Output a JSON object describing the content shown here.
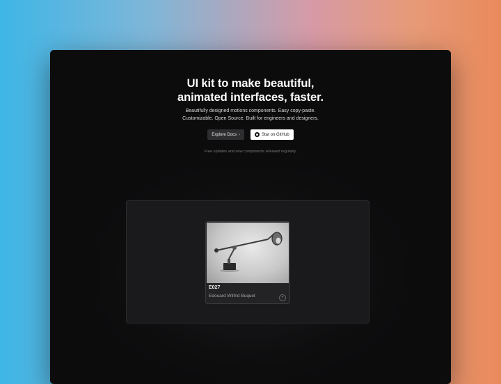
{
  "hero": {
    "headline_line1": "UI kit to make beautiful,",
    "headline_line2": "animated interfaces, faster.",
    "subtitle_line1": "Beautifully designed motions components. Easy copy-paste.",
    "subtitle_line2": "Customizable. Open Source. Built for engineers and designers.",
    "primary_button_label": "Explore Docs",
    "primary_button_icon": "arrow-right-icon",
    "secondary_button_label": "Star on GitHub",
    "secondary_button_icon": "github-icon",
    "note": "Free updates and new components released regularly."
  },
  "showcase": {
    "card": {
      "image_icon": "desk-lamp-image",
      "code": "E027",
      "name": "Edouard Wilfrid Buquet",
      "action_icon": "plus-icon"
    }
  },
  "colors": {
    "background_left": "#3eb6e6",
    "background_right": "#e98a5b",
    "window": "#0c0c0d",
    "panel": "#1a1a1c",
    "card": "#232325"
  }
}
